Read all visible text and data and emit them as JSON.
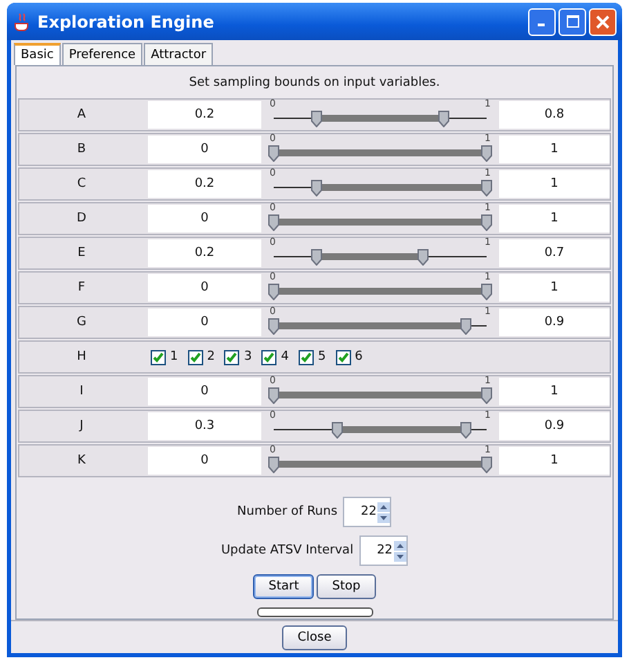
{
  "window": {
    "title": "Exploration Engine"
  },
  "tabs": [
    {
      "label": "Basic",
      "selected": true
    },
    {
      "label": "Preference",
      "selected": false
    },
    {
      "label": "Attractor",
      "selected": false
    }
  ],
  "instructions": "Set sampling bounds on input variables.",
  "variables": [
    {
      "kind": "range",
      "name": "A",
      "min": "0.2",
      "max": "0.8",
      "scale_min": "0",
      "scale_max": "1",
      "thumbs": [
        {
          "level": 0.2
        },
        {
          "level": 0.8
        }
      ]
    },
    {
      "kind": "range",
      "name": "B",
      "min": "0",
      "max": "1",
      "scale_min": "0",
      "scale_max": "1",
      "thumbs": [
        {
          "level": 0
        },
        {
          "level": 1
        }
      ]
    },
    {
      "kind": "range",
      "name": "C",
      "min": "0.2",
      "max": "1",
      "scale_min": "0",
      "scale_max": "1",
      "thumbs": [
        {
          "level": 0.2
        },
        {
          "level": 1
        }
      ]
    },
    {
      "kind": "range",
      "name": "D",
      "min": "0",
      "max": "1",
      "scale_min": "0",
      "scale_max": "1",
      "thumbs": [
        {
          "level": 0
        },
        {
          "level": 1
        }
      ]
    },
    {
      "kind": "range",
      "name": "E",
      "min": "0.2",
      "max": "0.7",
      "scale_min": "0",
      "scale_max": "1",
      "thumbs": [
        {
          "level": 0.2
        },
        {
          "level": 0.7
        }
      ]
    },
    {
      "kind": "range",
      "name": "F",
      "min": "0",
      "max": "1",
      "scale_min": "0",
      "scale_max": "1",
      "thumbs": [
        {
          "level": 0
        },
        {
          "level": 1
        }
      ]
    },
    {
      "kind": "range",
      "name": "G",
      "min": "0",
      "max": "0.9",
      "scale_min": "0",
      "scale_max": "1",
      "thumbs": [
        {
          "level": 0
        },
        {
          "level": 0.9
        }
      ]
    },
    {
      "kind": "choices",
      "name": "H",
      "options": [
        {
          "label": "1",
          "checked": true
        },
        {
          "label": "2",
          "checked": true
        },
        {
          "label": "3",
          "checked": true
        },
        {
          "label": "4",
          "checked": true
        },
        {
          "label": "5",
          "checked": true
        },
        {
          "label": "6",
          "checked": true
        }
      ]
    },
    {
      "kind": "range",
      "name": "I",
      "min": "0",
      "max": "1",
      "scale_min": "0",
      "scale_max": "1",
      "thumbs": [
        {
          "level": 0
        },
        {
          "level": 1
        }
      ]
    },
    {
      "kind": "range",
      "name": "J",
      "min": "0.3",
      "max": "0.9",
      "scale_min": "0",
      "scale_max": "1",
      "thumbs": [
        {
          "level": 0.3
        },
        {
          "level": 0.9
        }
      ]
    },
    {
      "kind": "range",
      "name": "K",
      "min": "0",
      "max": "1",
      "scale_min": "0",
      "scale_max": "1",
      "thumbs": [
        {
          "level": 0
        },
        {
          "level": 1
        }
      ]
    }
  ],
  "spinners": [
    {
      "label": "Number of Runs",
      "value": "22"
    },
    {
      "label": "Update ATSV Interval",
      "value": "22"
    }
  ],
  "buttons": [
    {
      "label": "Start",
      "focused": true
    },
    {
      "label": "Stop",
      "focused": false
    }
  ],
  "progress": {
    "level": 0
  },
  "close_button": "Close"
}
